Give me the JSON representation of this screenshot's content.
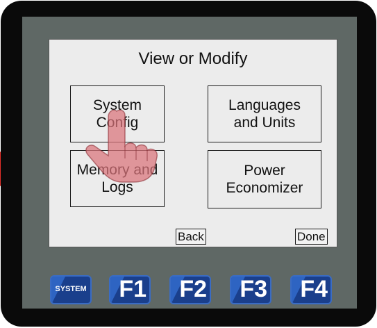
{
  "screen": {
    "title": "View or Modify",
    "buttons": [
      {
        "label": "System\nConfig"
      },
      {
        "label": "Languages\nand Units"
      },
      {
        "label": "Memory and\nLogs"
      },
      {
        "label": "Power\nEconomizer"
      }
    ],
    "back_label": "Back",
    "done_label": "Done"
  },
  "keys": [
    {
      "label": "SYSTEM"
    },
    {
      "label": "F1"
    },
    {
      "label": "F2"
    },
    {
      "label": "F3"
    },
    {
      "label": "F4"
    }
  ],
  "icons": {
    "pointer": "hand-pointer-icon",
    "arrow": "red-arrow-icon"
  },
  "colors": {
    "accent_arrow": "#e8302a",
    "key_blue": "#1a3f8c",
    "hand": "#d9737a"
  }
}
